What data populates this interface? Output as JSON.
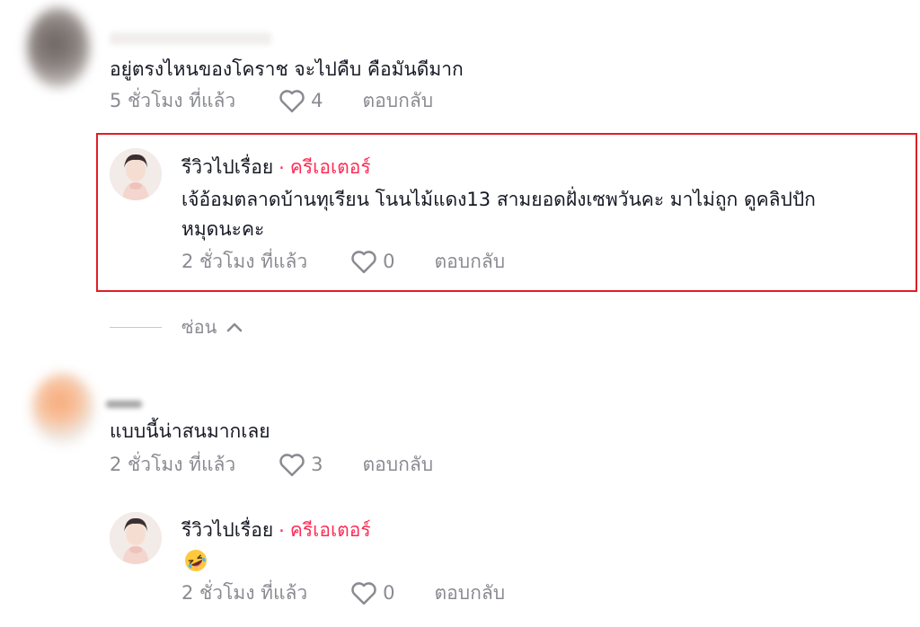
{
  "comments": [
    {
      "text": "อยู่ตรงไหนของโคราช จะไปคืบ คือมันดีมาก",
      "time": "5 ชั่วโมง ที่แล้ว",
      "likes": "4",
      "reply_label": "ตอบกลับ"
    },
    {
      "username": "รีวิวไปเรื่อย",
      "separator": "·",
      "badge": "ครีเอเตอร์",
      "text_line1": "เจ้อ้อมตลาดบ้านทุเรียน โนนไม้แดง13 สามยอดฝั่งเซพวันคะ มาไม่ถูก ดูคลิปปัก",
      "text_line2": "หมุดนะคะ",
      "time": "2 ชั่วโมง ที่แล้ว",
      "likes": "0",
      "reply_label": "ตอบกลับ"
    },
    {
      "text": "แบบนี้น่าสนมากเลย",
      "time": "2 ชั่วโมง ที่แล้ว",
      "likes": "3",
      "reply_label": "ตอบกลับ"
    },
    {
      "username": "รีวิวไปเรื่อย",
      "separator": "·",
      "badge": "ครีเอเตอร์",
      "emoji": "🤣",
      "time": "2 ชั่วโมง ที่แล้ว",
      "likes": "0",
      "reply_label": "ตอบกลับ"
    }
  ],
  "hide_replies_label": "ซ่อน",
  "colors": {
    "creator_badge": "#fe2c55",
    "highlight_border": "#e01e25",
    "meta_gray": "#8a8b91"
  }
}
